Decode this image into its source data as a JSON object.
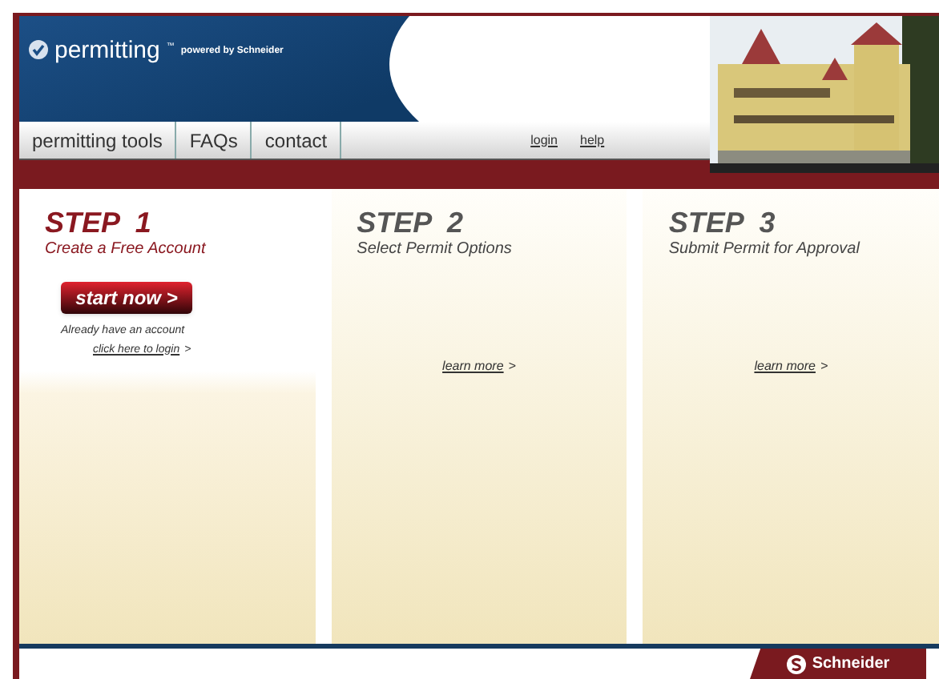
{
  "header": {
    "logo": "permitting",
    "trademark": "™",
    "tagline": "powered by Schneider"
  },
  "nav": {
    "tabs": [
      "permitting tools",
      "FAQs",
      "contact"
    ],
    "links": [
      "login",
      "help"
    ]
  },
  "steps": [
    {
      "title": "STEP  1",
      "subtitle": "Create a Free Account",
      "selected": true,
      "button": "start now >",
      "note": "Already have an account",
      "link": "click here to login",
      "link_suffix": ">"
    },
    {
      "title": "STEP  2",
      "subtitle": "Select Permit Options",
      "selected": false,
      "link": "learn more",
      "link_suffix": ">"
    },
    {
      "title": "STEP  3",
      "subtitle": "Submit Permit for Approval",
      "selected": false,
      "link": "learn more",
      "link_suffix": ">"
    }
  ],
  "footer": {
    "brand": "Schneider"
  }
}
